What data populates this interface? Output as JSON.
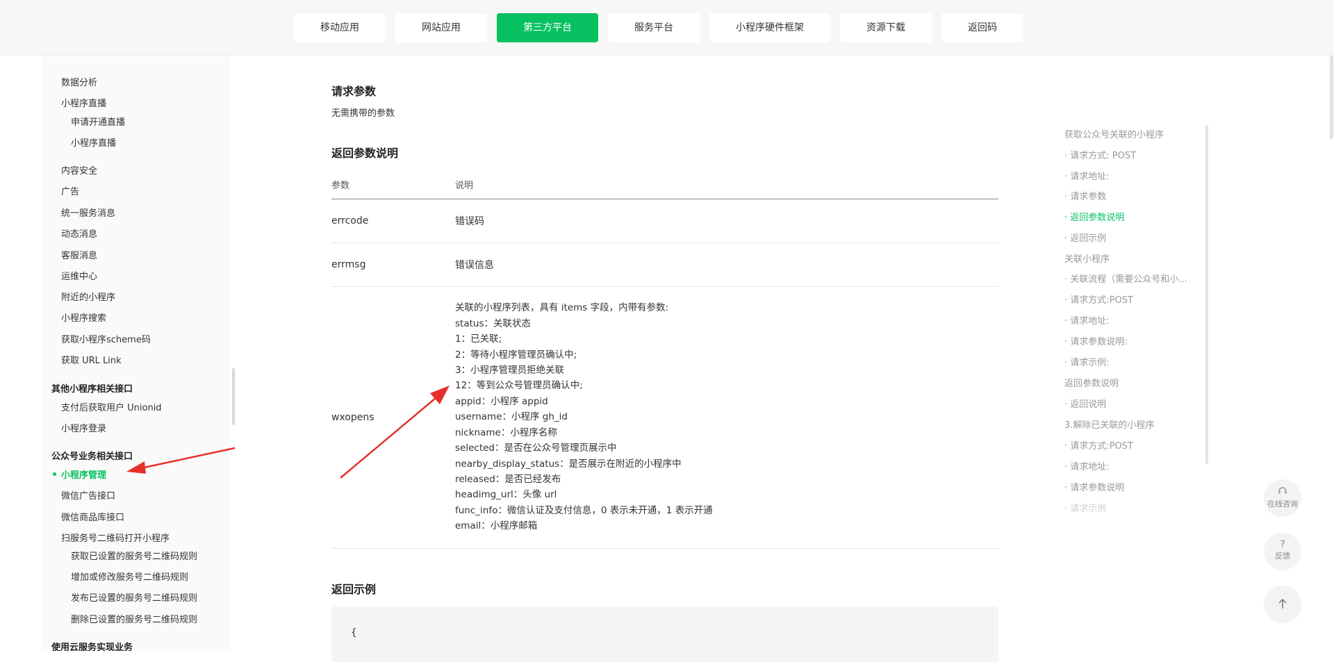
{
  "topnav": {
    "tabs": [
      {
        "label": "移动应用",
        "active": false
      },
      {
        "label": "网站应用",
        "active": false
      },
      {
        "label": "第三方平台",
        "active": true
      },
      {
        "label": "服务平台",
        "active": false
      },
      {
        "label": "小程序硬件框架",
        "active": false
      },
      {
        "label": "资源下载",
        "active": false
      },
      {
        "label": "返回码",
        "active": false
      }
    ]
  },
  "sidebar": {
    "items": [
      {
        "label": "数据分析"
      },
      {
        "label": "小程序直播"
      },
      {
        "label": "申请开通直播"
      },
      {
        "label": "小程序直播"
      },
      {
        "label": "内容安全"
      },
      {
        "label": "广告"
      },
      {
        "label": "统一服务消息"
      },
      {
        "label": "动态消息"
      },
      {
        "label": "客服消息"
      },
      {
        "label": "运维中心"
      },
      {
        "label": "附近的小程序"
      },
      {
        "label": "小程序搜索"
      },
      {
        "label": "获取小程序scheme码"
      },
      {
        "label": "获取 URL Link"
      },
      {
        "label": "其他小程序相关接口"
      },
      {
        "label": "支付后获取用户 Unionid"
      },
      {
        "label": "小程序登录"
      },
      {
        "label": "公众号业务相关接口"
      },
      {
        "label": "小程序管理"
      },
      {
        "label": "微信广告接口"
      },
      {
        "label": "微信商品库接口"
      },
      {
        "label": "扫服务号二维码打开小程序"
      },
      {
        "label": "获取已设置的服务号二维码规则"
      },
      {
        "label": "增加或修改服务号二维码规则"
      },
      {
        "label": "发布已设置的服务号二维码规则"
      },
      {
        "label": "删除已设置的服务号二维码规则"
      },
      {
        "label": "使用云服务实现业务"
      }
    ]
  },
  "main": {
    "request_params_title": "请求参数",
    "request_params_text": "无需携带的参数",
    "return_params_title": "返回参数说明",
    "table": {
      "headers": [
        "参数",
        "说明"
      ],
      "rows": [
        {
          "param": "errcode",
          "desc": "错误码"
        },
        {
          "param": "errmsg",
          "desc": "错误信息"
        },
        {
          "param": "wxopens",
          "desc_lines": [
            "关联的小程序列表，具有 items 字段，内带有参数:",
            "status：关联状态",
            "1：已关联;",
            "2：等待小程序管理员确认中;",
            "3：小程序管理员拒绝关联",
            "12：等到公众号管理员确认中;",
            "appid：小程序 appid",
            "username：小程序 gh_id",
            "nickname：小程序名称",
            "selected：是否在公众号管理页展示中",
            "nearby_display_status：是否展示在附近的小程序中",
            "released：是否已经发布",
            "headimg_url：头像 url",
            "func_info：微信认证及支付信息，0 表示未开通，1 表示开通",
            "email：小程序邮箱"
          ]
        }
      ]
    },
    "return_example_title": "返回示例",
    "code_first_line": "{"
  },
  "toc": {
    "items": [
      {
        "label": "获取公众号关联的小程序"
      },
      {
        "label": "· 请求方式: POST"
      },
      {
        "label": "· 请求地址:"
      },
      {
        "label": "· 请求参数"
      },
      {
        "label": "· 返回参数说明",
        "active": true
      },
      {
        "label": "· 返回示例"
      },
      {
        "label": "关联小程序"
      },
      {
        "label": "· 关联流程（需要公众号和小..."
      },
      {
        "label": "· 请求方式:POST"
      },
      {
        "label": "· 请求地址:"
      },
      {
        "label": "· 请求参数说明:"
      },
      {
        "label": "· 请求示例:"
      },
      {
        "label": "返回参数说明"
      },
      {
        "label": "· 返回说明"
      },
      {
        "label": "3.解除已关联的小程序"
      },
      {
        "label": "· 请求方式:POST"
      },
      {
        "label": "· 请求地址:"
      },
      {
        "label": "· 请求参数说明"
      },
      {
        "label": "· 请求示例"
      }
    ]
  },
  "float": {
    "consult_label": "在线咨询",
    "feedback_label": "反馈",
    "feedback_glyph": "?",
    "consult_icon": "headset-icon",
    "top_icon": "arrow-up-icon"
  },
  "colors": {
    "accent": "#07c160",
    "arrow": "#e8302a"
  }
}
